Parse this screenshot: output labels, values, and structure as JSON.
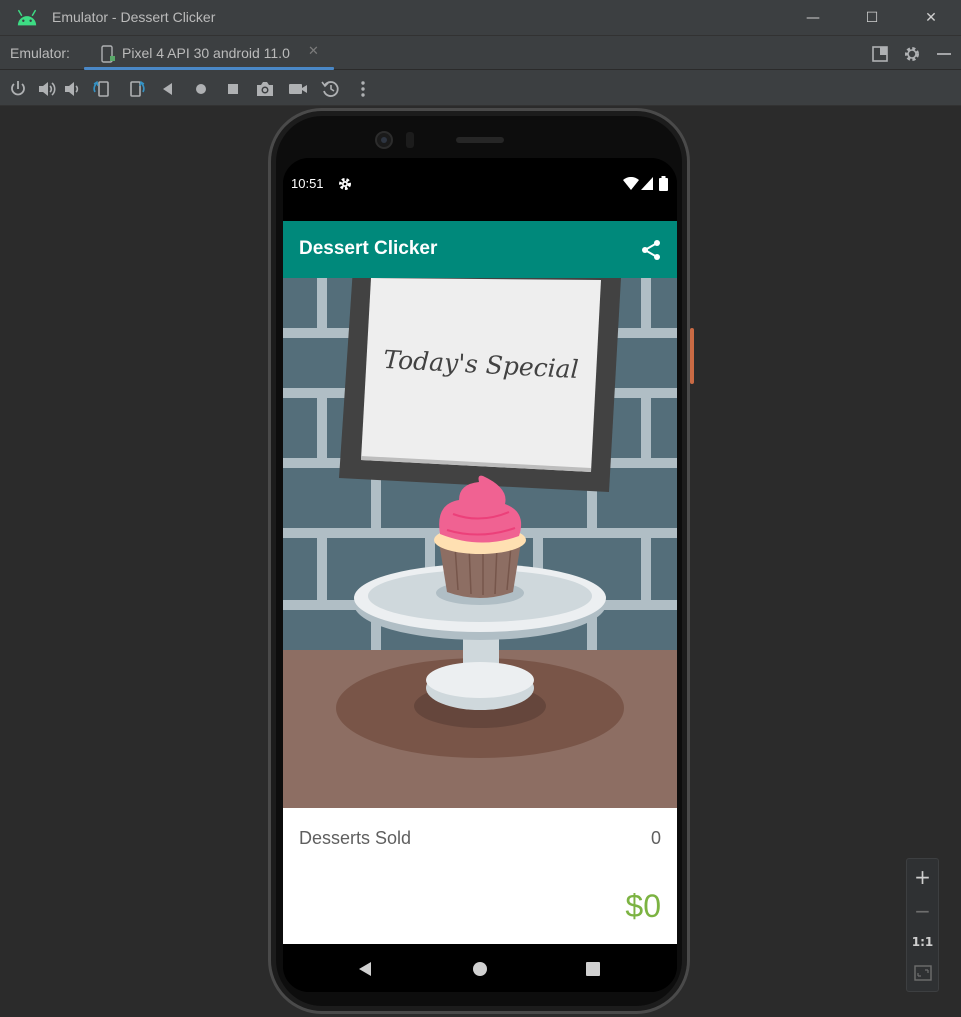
{
  "window": {
    "title": "Emulator - Dessert Clicker",
    "minimize_glyph": "—",
    "maximize_glyph": "☐",
    "close_glyph": "✕"
  },
  "tabbar": {
    "label": "Emulator:",
    "tab_label": "Pixel 4 API 30 android 11.0",
    "tab_close_glyph": "✕"
  },
  "toolbar": {
    "items": [
      "power-icon",
      "volume-up-icon",
      "volume-down-icon",
      "rotate-left-icon",
      "rotate-right-icon",
      "back-icon",
      "home-icon",
      "overview-icon",
      "screenshot-icon",
      "screen-record-icon",
      "snapshot-icon",
      "more-icon"
    ]
  },
  "device": {
    "status_time": "10:51",
    "app_title": "Dessert Clicker",
    "sign_text": "Today's Special",
    "desserts_sold_label": "Desserts Sold",
    "desserts_sold_value": "0",
    "revenue": "$0"
  },
  "zoom": {
    "zoom_in": "+",
    "zoom_out": "−",
    "actual_size": "1:1"
  },
  "colors": {
    "appbar": "#00897b",
    "revenue": "#7cb342",
    "ide_background": "#2b2b2b",
    "tab_underline": "#4a88c7"
  }
}
